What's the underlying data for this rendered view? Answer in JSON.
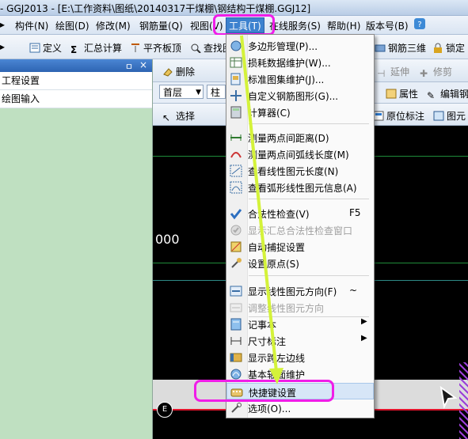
{
  "window": {
    "title": "- GGJ2013 - [E:\\工作资料\\图纸\\20140317干煤棚\\钢结构干煤棚.GGJ12]"
  },
  "menubar": {
    "items": [
      {
        "label": "构件(N)"
      },
      {
        "label": "绘图(D)"
      },
      {
        "label": "修改(M)"
      },
      {
        "label": "钢筋量(Q)"
      },
      {
        "label": "视图(V)"
      },
      {
        "label": "工具(T)"
      },
      {
        "label": "在线服务(S)"
      },
      {
        "label": "帮助(H)"
      },
      {
        "label": "版本号(B)"
      }
    ]
  },
  "toolbar1": {
    "items": [
      {
        "label": "定义"
      },
      {
        "label": "汇总计算"
      },
      {
        "label": "平齐板顶"
      },
      {
        "label": "查找图"
      },
      {
        "label": "钢筋三维"
      },
      {
        "label": "锁定"
      }
    ]
  },
  "left_panel": {
    "header_pin": " ᵖ",
    "close_glyph": "×",
    "rows": [
      {
        "label": "工程设置"
      },
      {
        "label": "绘图输入"
      }
    ]
  },
  "toolbar2": {
    "delete_label": "删除",
    "extend_label": "延伸",
    "trim_label": "修剪"
  },
  "toolbar3": {
    "floor_value": "首层",
    "type_value": "柱",
    "property_label": "属性",
    "edit_label": "编辑钢"
  },
  "toolbar4": {
    "select_label": "选择",
    "origin_label": "原位标注",
    "element_label": "图元"
  },
  "canvas": {
    "number_text": "000",
    "axis_label": "E"
  },
  "tools_menu": {
    "items": [
      {
        "label": "多边形管理(P)...",
        "icon": "polygon-icon"
      },
      {
        "label": "损耗数据维护(W)...",
        "icon": "table-icon"
      },
      {
        "label": "标准图集维护(J)...",
        "icon": "atlas-icon"
      },
      {
        "label": "自定义钢筋图形(G)...",
        "icon": "shape-icon"
      },
      {
        "label": "计算器(C)",
        "icon": "calculator-icon"
      },
      {
        "label": "测量两点间距离(D)",
        "icon": "ruler-icon"
      },
      {
        "label": "测量两点间弧线长度(M)",
        "icon": "arc-icon"
      },
      {
        "label": "查看线性图元长度(N)",
        "icon": "line-length-icon"
      },
      {
        "label": "查看弧形线性图元信息(A)",
        "icon": "arc-info-icon"
      },
      {
        "label": "合法性检查(V)",
        "icon": "check-icon",
        "shortcut": "F5"
      },
      {
        "label": "显示汇总合法性检查窗口",
        "icon": "check-window-icon",
        "disabled": true
      },
      {
        "label": "自动捕捉设置",
        "icon": "snap-icon"
      },
      {
        "label": "设置原点(S)",
        "icon": "origin-icon"
      },
      {
        "label": "显示线性图元方向(F)",
        "icon": "direction-icon",
        "shortcut": "~"
      },
      {
        "label": "调整线性图元方向",
        "icon": "adjust-direction-icon",
        "disabled": true
      },
      {
        "label": "记事本",
        "icon": "notepad-icon",
        "submenu": true
      },
      {
        "label": "尺寸标注",
        "icon": "dimension-icon",
        "submenu": true
      },
      {
        "label": "显示跨左边线",
        "icon": "span-edge-icon"
      },
      {
        "label": "基本轴面维护",
        "icon": "axis-icon"
      },
      {
        "label": "快捷键设置",
        "icon": "keyboard-icon",
        "highlighted": true
      },
      {
        "label": "选项(O)...",
        "icon": "options-icon"
      }
    ]
  },
  "colors": {
    "annotation_pink": "#f01de8",
    "annotation_arrow": "#d4f23a",
    "menu_active": "#3d82cf"
  }
}
